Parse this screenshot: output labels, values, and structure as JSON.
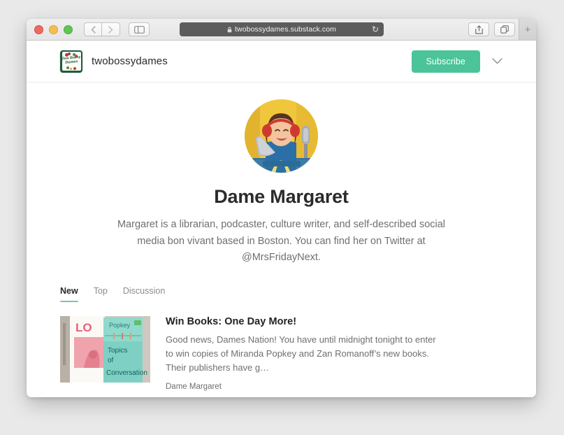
{
  "browser": {
    "traffic_lights": [
      "close",
      "minimize",
      "zoom"
    ],
    "back_label": "‹",
    "forward_label": "›",
    "sidebar_label": "sidebar-toggle",
    "url": "twobossydames.substack.com",
    "lock": "lock-icon",
    "reload": "↻",
    "share": "share-icon",
    "tabs_overview": "tabs-icon",
    "new_tab": "+"
  },
  "site": {
    "header": {
      "logo_alt": "Two Bossy Dames",
      "logo_line1": "Two Bossy",
      "logo_line2": "Dames",
      "brand_name": "twobossydames",
      "subscribe_label": "Subscribe",
      "chevron": "⌄"
    },
    "profile": {
      "avatar_alt": "Dame Margaret portrait",
      "name": "Dame Margaret",
      "bio": "Margaret is a librarian, podcaster, culture writer, and self-described social media bon vivant based in Boston. You can find her on Twitter at @MrsFridayNext."
    },
    "tabs": [
      {
        "label": "New",
        "active": true
      },
      {
        "label": "Top",
        "active": false
      },
      {
        "label": "Discussion",
        "active": false
      }
    ],
    "posts": [
      {
        "thumb_alt": "Two book covers: Topics of Conversation by Miranda Popkey",
        "thumb_text_1": "LO",
        "thumb_text_2": "Popkey",
        "thumb_text_3": "Topics",
        "thumb_text_4": "of",
        "thumb_text_5": "Conversation",
        "title": "Win Books: One Day More!",
        "excerpt": "Good news, Dames Nation! You have until midnight tonight to enter to win copies of Miranda Popkey and Zan Romanoff’s new books. Their publishers have g…",
        "author": "Dame Margaret"
      }
    ]
  },
  "colors": {
    "accent_green": "#4bc49a",
    "tab_underline": "#86bfb0",
    "logo_green": "#1e5c3d",
    "page_background": "#e9e9e9",
    "url_bar": "#5c5c5c"
  }
}
